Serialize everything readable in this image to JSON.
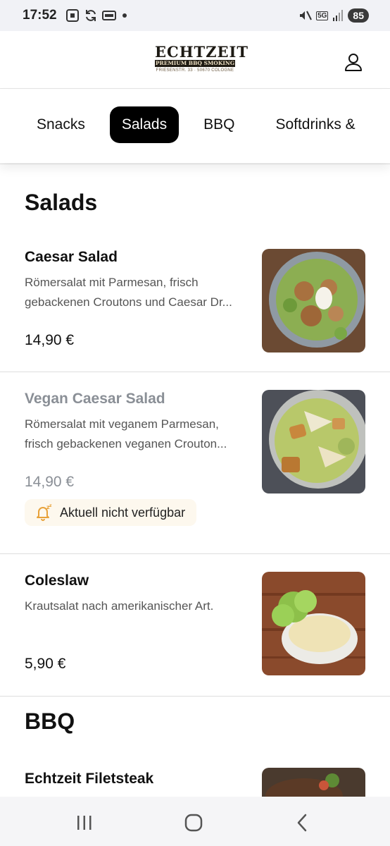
{
  "status_bar": {
    "time": "17:52",
    "network": "5G",
    "battery": "85",
    "icons": [
      "screenshot-icon",
      "sync-icon",
      "card-icon",
      "dot-icon",
      "mute-icon",
      "data-arrows-icon",
      "signal-icon"
    ]
  },
  "header": {
    "logo_title": "ECHTZEIT",
    "logo_subtitle": "PREMIUM BBQ SMOKING",
    "logo_address": "FRIESENSTR. 33 · 50670 COLOGNE",
    "account_icon": "user-icon"
  },
  "tabs": [
    {
      "label": "Snacks",
      "active": false
    },
    {
      "label": "Salads",
      "active": true
    },
    {
      "label": "BBQ",
      "active": false
    },
    {
      "label": "Softdrinks &",
      "active": false
    }
  ],
  "sections": [
    {
      "title": "Salads",
      "items": [
        {
          "name": "Caesar Salad",
          "desc_line1": "Römersalat mit Parmesan, frisch",
          "desc_line2": "gebackenen Croutons und Caesar Dr...",
          "price": "14,90 €",
          "available": true
        },
        {
          "name": "Vegan Caesar Salad",
          "desc_line1": "Römersalat mit veganem Parmesan,",
          "desc_line2": "frisch gebackenen veganen Crouton...",
          "price": "14,90 €",
          "available": false,
          "unavailable_label": "Aktuell nicht verfügbar"
        },
        {
          "name": "Coleslaw",
          "desc_line1": "Krautsalat nach amerikanischer Art.",
          "desc_line2": "",
          "price": "5,90 €",
          "available": true
        }
      ]
    },
    {
      "title": "BBQ",
      "items": [
        {
          "name": "Echtzeit Filetsteak",
          "desc_line1": "",
          "desc_line2": "",
          "price": "",
          "available": true
        }
      ]
    }
  ],
  "colors": {
    "accent_black": "#000000",
    "muted_text": "#8a8f96",
    "unavailable_bg": "#fdf8ee",
    "unavailable_icon": "#e8a23a"
  },
  "nav_bar": {
    "icons": [
      "recent-apps-icon",
      "home-icon",
      "back-icon"
    ]
  }
}
